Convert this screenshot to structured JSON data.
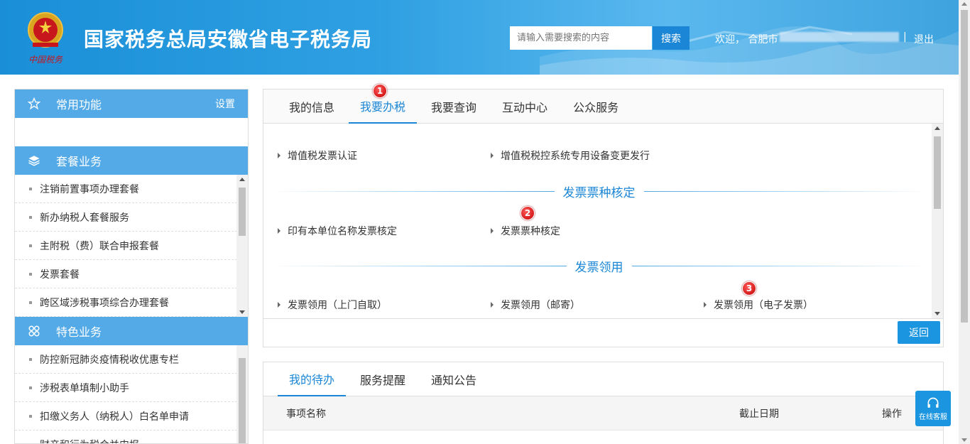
{
  "header": {
    "site_title": "国家税务总局安徽省电子税务局",
    "search_placeholder": "请输入需要搜索的内容",
    "search_button": "搜索",
    "welcome": "欢迎，  合肥市",
    "separator": "|",
    "logout": "退出",
    "brand_color": "#1a8fd8"
  },
  "sidebar": {
    "common": {
      "title": "常用功能",
      "settings": "设置",
      "icon": "star-icon"
    },
    "package": {
      "title": "套餐业务",
      "icon": "layers-icon",
      "items": [
        "注销前置事项办理套餐",
        "新办纳税人套餐服务",
        "主附税（费）联合申报套餐",
        "发票套餐",
        "跨区域涉税事项综合办理套餐"
      ]
    },
    "special": {
      "title": "特色业务",
      "icon": "clover-icon",
      "items": [
        "防控新冠肺炎疫情税收优惠专栏",
        "涉税表单填制小助手",
        "扣缴义务人（纳税人）白名单申请",
        "财产和行为税合并申报"
      ]
    }
  },
  "main": {
    "tabs": [
      "我的信息",
      "我要办税",
      "我要查询",
      "互动中心",
      "公众服务"
    ],
    "active_tab": "我要办税",
    "row1": [
      "增值税发票认证",
      "增值税税控系统专用设备变更发行"
    ],
    "section2_title": "发票票种核定",
    "row2": [
      "印有本单位名称发票核定",
      "发票票种核定"
    ],
    "section3_title": "发票领用",
    "row3": [
      "发票领用（上门自取）",
      "发票领用（邮寄）",
      "发票领用（电子发票）"
    ],
    "back_button": "返回",
    "badges": [
      "1",
      "2",
      "3"
    ]
  },
  "todo": {
    "tabs": [
      "我的待办",
      "服务提醒",
      "通知公告"
    ],
    "active_tab": "我的待办",
    "columns": [
      "事项名称",
      "截止日期",
      "操作"
    ]
  },
  "service": {
    "label": "在线客服",
    "icon": "headset-icon"
  }
}
